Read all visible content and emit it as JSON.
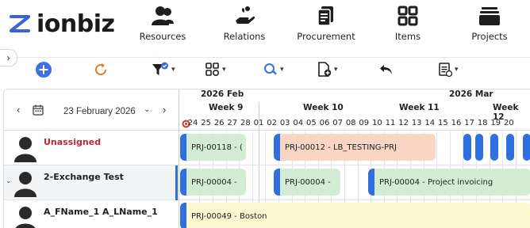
{
  "app": {
    "logo_text": "ionbiz",
    "brand_color": "#3b63d9"
  },
  "nav": {
    "items": [
      {
        "label": "Resources",
        "icon": "resources-icon"
      },
      {
        "label": "Relations",
        "icon": "relations-icon"
      },
      {
        "label": "Procurement",
        "icon": "procurement-icon"
      },
      {
        "label": "Items",
        "icon": "items-icon"
      },
      {
        "label": "Projects",
        "icon": "projects-icon"
      }
    ]
  },
  "toolbar": {
    "add_icon": "add-circle-icon",
    "refresh_icon": "refresh-icon",
    "filter_icon": "filter-icon",
    "group_icon": "group-icon",
    "search_icon": "search-icon",
    "new_doc_icon": "new-document-icon",
    "undo_icon": "undo-icon",
    "export_icon": "export-icon"
  },
  "planner": {
    "date_label": "23 February 2026",
    "months": [
      "2026 Feb",
      "2026 Mar"
    ],
    "weeks": [
      "Week 9",
      "Week 10",
      "Week 11",
      "Week 12"
    ],
    "days": [
      "24",
      "25",
      "26",
      "27",
      "28",
      "01",
      "02",
      "03",
      "04",
      "05",
      "06",
      "07",
      "08",
      "09",
      "10",
      "11",
      "12",
      "13",
      "14",
      "15",
      "16",
      "17",
      "18",
      "19",
      "20"
    ],
    "resources": [
      {
        "name": "Unassigned",
        "highlight": true
      },
      {
        "name": "2-Exchange Test",
        "highlight": false
      },
      {
        "name": "A_FName_1 A_LName_1",
        "highlight": false
      }
    ],
    "bars": {
      "r1_a": "PRJ-00118 - (",
      "r1_b": "PRJ-00012 - LB_TESTING-PRJ",
      "r2_a": "PRJ-00004 -",
      "r2_b": "PRJ-00004 -",
      "r2_c": "PRJ-00004 - Project invoicing",
      "r3_a": "PRJ-00049 - Boston"
    },
    "colors": {
      "accent_blue": "#2f6fe0",
      "green": "#d4ecd4",
      "peach": "#f8d6c3",
      "yellow": "#fcf8cf",
      "alert_red": "#c0272d"
    }
  }
}
